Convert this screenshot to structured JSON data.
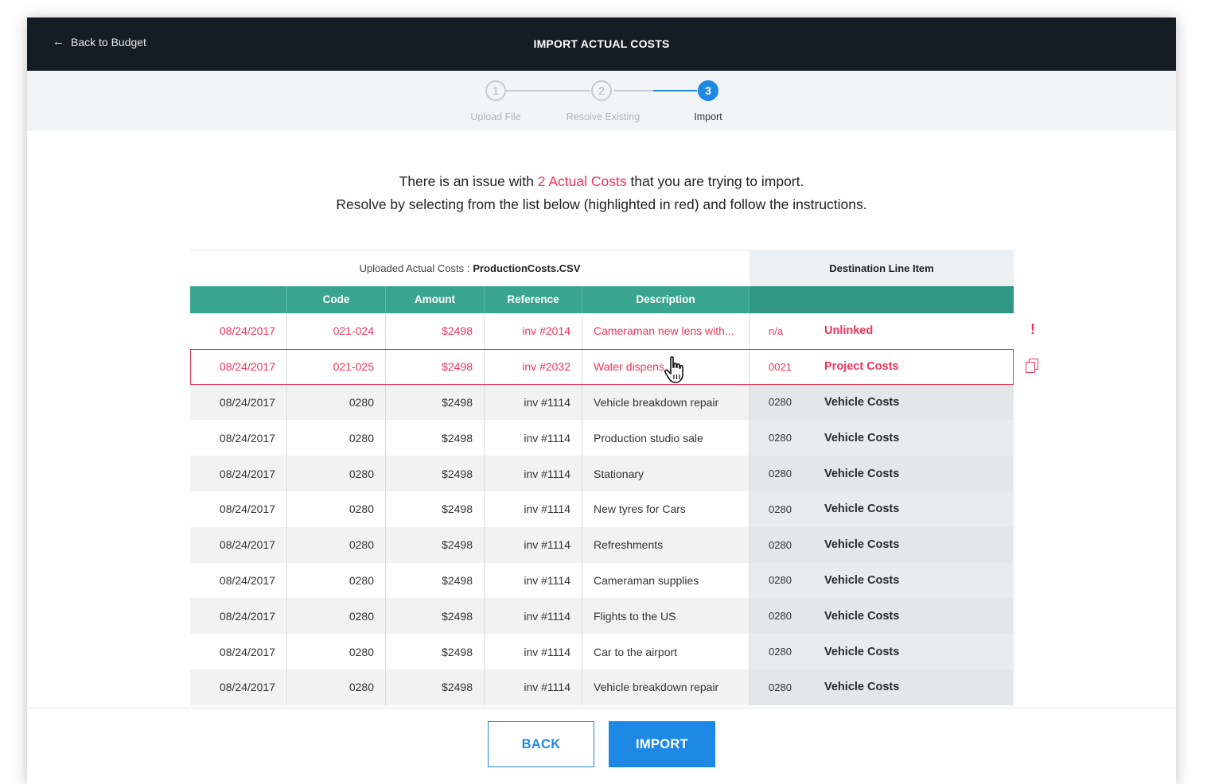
{
  "header": {
    "back_label": "Back to Budget",
    "title": "IMPORT ACTUAL COSTS"
  },
  "stepper": {
    "steps": [
      {
        "num": "1",
        "label": "Upload File"
      },
      {
        "num": "2",
        "label": "Resolve Existing"
      },
      {
        "num": "3",
        "label": "Import"
      }
    ],
    "active_step": 3
  },
  "message": {
    "line1_pre": "There is an issue with ",
    "line1_highlight": "2 Actual Costs",
    "line1_post": " that you are trying to import.",
    "line2": "Resolve by selecting from the list below (highlighted in red) and follow the instructions."
  },
  "table": {
    "caption_label": "Uploaded Actual Costs :",
    "caption_file": "ProductionCosts.CSV",
    "destination_label": "Destination Line Item",
    "columns": [
      "",
      "Code",
      "Amount",
      "Reference",
      "Description",
      ""
    ],
    "rows": [
      {
        "date": "08/24/2017",
        "code": "021-024",
        "amount": "$2498",
        "ref": "inv #2014",
        "desc": "Cameraman new lens with...",
        "dcode": "n/a",
        "dname": "Unlinked",
        "status": "error",
        "icon": "exclamation-icon"
      },
      {
        "date": "08/24/2017",
        "code": "021-025",
        "amount": "$2498",
        "ref": "inv #2032",
        "desc": "Water dispens",
        "dcode": "0021",
        "dname": "Project Costs",
        "status": "error-selected",
        "icon": "copy-icon"
      },
      {
        "date": "08/24/2017",
        "code": "0280",
        "amount": "$2498",
        "ref": "inv #1114",
        "desc": "Vehicle breakdown repair",
        "dcode": "0280",
        "dname": "Vehicle Costs",
        "status": "ok"
      },
      {
        "date": "08/24/2017",
        "code": "0280",
        "amount": "$2498",
        "ref": "inv #1114",
        "desc": "Production studio sale",
        "dcode": "0280",
        "dname": "Vehicle Costs",
        "status": "ok"
      },
      {
        "date": "08/24/2017",
        "code": "0280",
        "amount": "$2498",
        "ref": "inv #1114",
        "desc": "Stationary",
        "dcode": "0280",
        "dname": "Vehicle Costs",
        "status": "ok"
      },
      {
        "date": "08/24/2017",
        "code": "0280",
        "amount": "$2498",
        "ref": "inv #1114",
        "desc": "New tyres for Cars",
        "dcode": "0280",
        "dname": "Vehicle Costs",
        "status": "ok"
      },
      {
        "date": "08/24/2017",
        "code": "0280",
        "amount": "$2498",
        "ref": "inv #1114",
        "desc": "Refreshments",
        "dcode": "0280",
        "dname": "Vehicle Costs",
        "status": "ok"
      },
      {
        "date": "08/24/2017",
        "code": "0280",
        "amount": "$2498",
        "ref": "inv #1114",
        "desc": "Cameraman supplies",
        "dcode": "0280",
        "dname": "Vehicle Costs",
        "status": "ok"
      },
      {
        "date": "08/24/2017",
        "code": "0280",
        "amount": "$2498",
        "ref": "inv #1114",
        "desc": "Flights to the US",
        "dcode": "0280",
        "dname": "Vehicle Costs",
        "status": "ok"
      },
      {
        "date": "08/24/2017",
        "code": "0280",
        "amount": "$2498",
        "ref": "inv #1114",
        "desc": "Car to the airport",
        "dcode": "0280",
        "dname": "Vehicle Costs",
        "status": "ok"
      },
      {
        "date": "08/24/2017",
        "code": "0280",
        "amount": "$2498",
        "ref": "inv #1114",
        "desc": "Vehicle breakdown repair",
        "dcode": "0280",
        "dname": "Vehicle Costs",
        "status": "ok"
      }
    ]
  },
  "footer": {
    "back_label": "BACK",
    "import_label": "IMPORT"
  },
  "colors": {
    "topbar": "#141c24",
    "accent": "#1e88e5",
    "table_header": "#3aa58f",
    "error": "#f0345a"
  }
}
